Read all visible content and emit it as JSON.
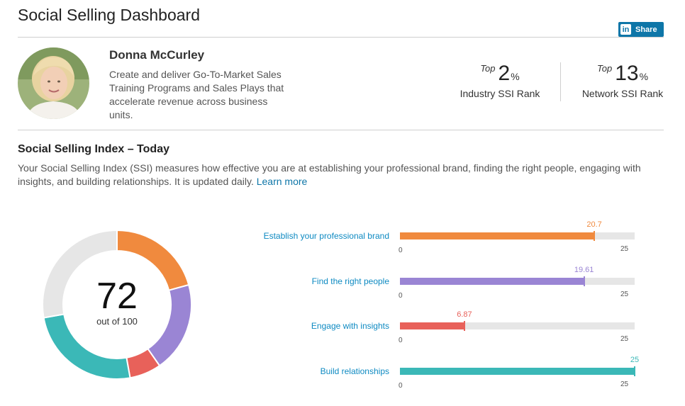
{
  "page": {
    "title": "Social Selling Dashboard",
    "share_label": "Share",
    "share_icon": "linkedin-icon",
    "share_icon_text": "in"
  },
  "profile": {
    "name": "Donna McCurley",
    "headline": "Create and deliver Go-To-Market Sales Training Programs and Sales Plays that accelerate revenue across business units."
  },
  "ranks": [
    {
      "prefix": "Top",
      "value": "2",
      "unit": "%",
      "label": "Industry SSI Rank"
    },
    {
      "prefix": "Top",
      "value": "13",
      "unit": "%",
      "label": "Network SSI Rank"
    }
  ],
  "ssi": {
    "heading": "Social Selling Index – Today",
    "description": "Your Social Selling Index (SSI) measures how effective you are at establishing your professional brand, finding the right people, engaging with insights, and building relationships. It is updated daily. ",
    "learn_more": "Learn more",
    "score": "72",
    "score_caption": "out of 100"
  },
  "chart_data": {
    "type": "bar",
    "orientation": "horizontal",
    "xlim": [
      0,
      25
    ],
    "tick_min_label": "0",
    "tick_max_label": "25",
    "total": 72,
    "total_max": 100,
    "series": [
      {
        "name": "Establish your professional brand",
        "value": 20.7,
        "label": "20.7",
        "color": "#f08a3e"
      },
      {
        "name": "Find the right people",
        "value": 19.61,
        "label": "19.61",
        "color": "#9a85d4"
      },
      {
        "name": "Engage with insights",
        "value": 6.87,
        "label": "6.87",
        "color": "#e8615a"
      },
      {
        "name": "Build relationships",
        "value": 25,
        "label": "25",
        "color": "#3bb8b7"
      }
    ],
    "remainder_color": "#e6e6e6"
  }
}
